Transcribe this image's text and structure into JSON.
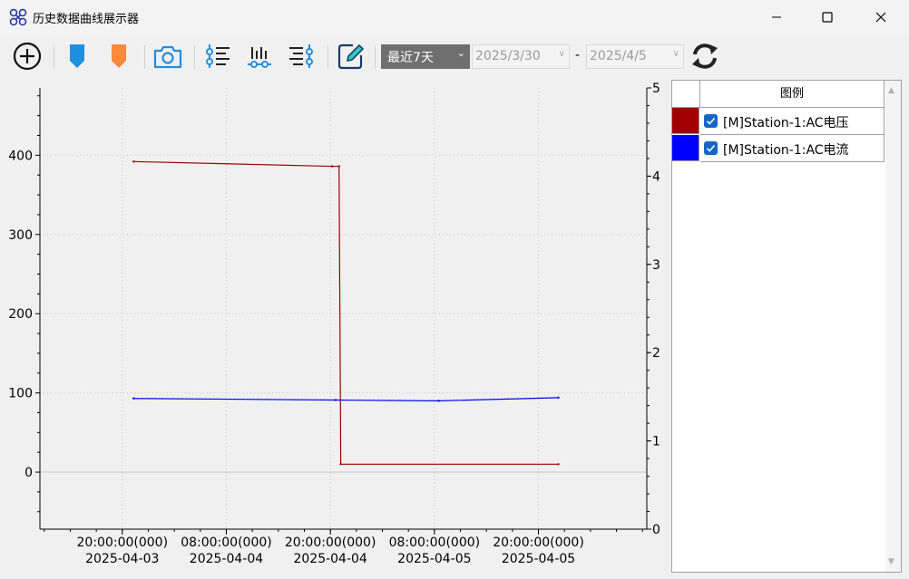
{
  "window": {
    "title": "历史数据曲线展示器",
    "controls": {
      "minimize": "—",
      "maximize": "☐",
      "close": "✕"
    }
  },
  "toolbar": {
    "icons": [
      "add-circle-icon",
      "blue-marker-icon",
      "orange-marker-icon",
      "camera-icon",
      "align-left-icon",
      "align-bottom-icon",
      "align-right-icon",
      "edit-icon",
      "refresh-icon"
    ],
    "range_select": {
      "value": "最近7天",
      "arrow": "⌄"
    },
    "start_date": {
      "value": "2025/3/30",
      "arrow": "∨"
    },
    "separator": "-",
    "end_date": {
      "value": "2025/4/5",
      "arrow": "∨"
    }
  },
  "chart_data": {
    "type": "line",
    "x_tick_labels": [
      {
        "time": "20:00:00(000)",
        "date": "2025-04-03"
      },
      {
        "time": "08:00:00(000)",
        "date": "2025-04-04"
      },
      {
        "time": "20:00:00(000)",
        "date": "2025-04-04"
      },
      {
        "time": "08:00:00(000)",
        "date": "2025-04-05"
      },
      {
        "time": "20:00:00(000)",
        "date": "2025-04-05"
      }
    ],
    "x_tick_hours": [
      0,
      12,
      24,
      36,
      48
    ],
    "xlim_hours": [
      -9.5,
      60.5
    ],
    "y_left": {
      "ticks": [
        0,
        100,
        200,
        300,
        400
      ],
      "ylim": [
        -72,
        485
      ]
    },
    "y_right": {
      "ticks": [
        0,
        1,
        2,
        3,
        4,
        5
      ],
      "ylim": [
        0,
        5
      ]
    },
    "grid": true,
    "series": [
      {
        "name": "[M]Station-1:AC电压",
        "color": "#a00000",
        "x": [
          1.3,
          24.2,
          25.0,
          25.2,
          50.3
        ],
        "y": [
          392,
          386,
          386,
          10,
          10
        ]
      },
      {
        "name": "[M]Station-1:AC电流",
        "color": "#0000ff",
        "x": [
          1.3,
          24.6,
          36.5,
          50.3
        ],
        "y": [
          93,
          91,
          90,
          94
        ]
      }
    ]
  },
  "legend": {
    "header": "图例",
    "items": [
      {
        "label": "[M]Station-1:AC电压",
        "color": "#a00000",
        "checked": true
      },
      {
        "label": "[M]Station-1:AC电流",
        "color": "#0000ff",
        "checked": true
      }
    ],
    "scroll_up": "▲",
    "scroll_down": "▼"
  }
}
